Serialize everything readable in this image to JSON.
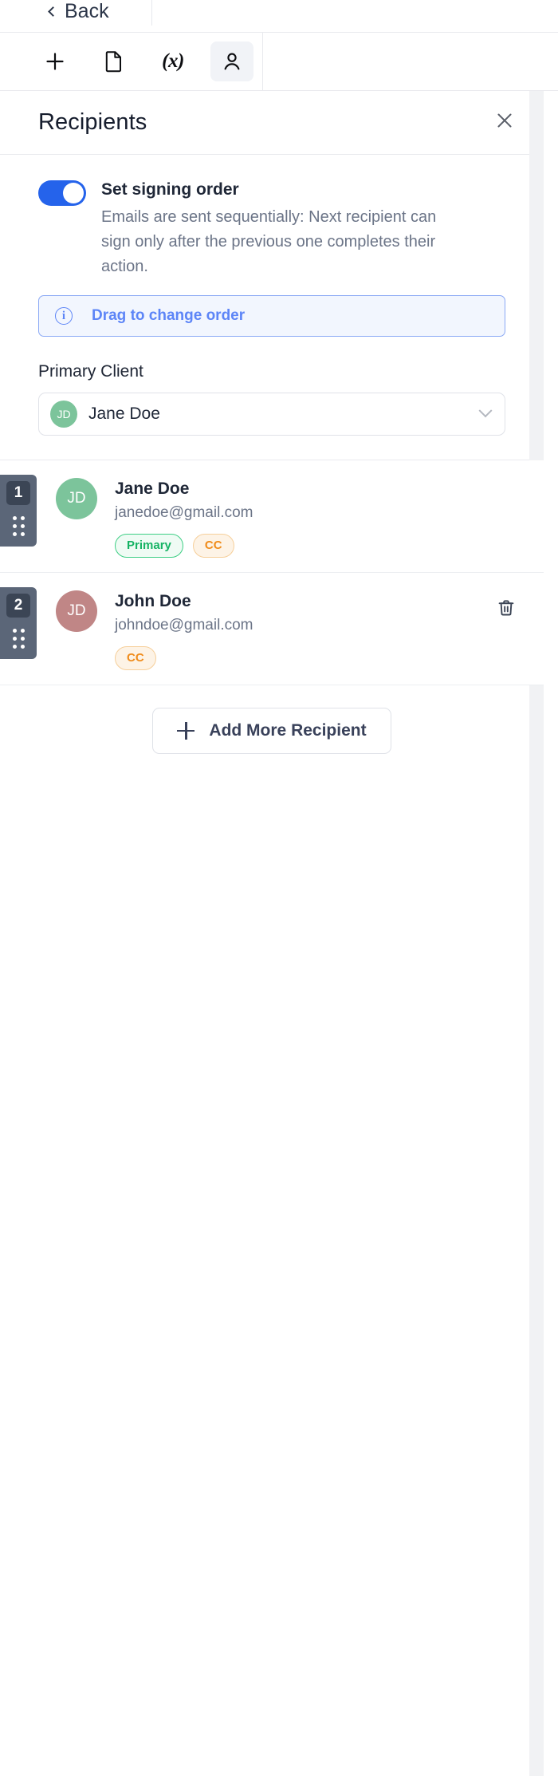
{
  "topbar": {
    "back_label": "Back",
    "back_icon": "chevron-left-icon"
  },
  "toolbar": {
    "tools": [
      {
        "id": "add",
        "icon": "plus-icon",
        "label": "",
        "active": false
      },
      {
        "id": "document",
        "icon": "document-icon",
        "label": "",
        "active": false
      },
      {
        "id": "variable",
        "icon": "variable-icon",
        "label": "(x)",
        "active": false
      },
      {
        "id": "recipients",
        "icon": "person-icon",
        "label": "",
        "active": true
      }
    ]
  },
  "panel": {
    "title": "Recipients",
    "close_icon": "close-icon"
  },
  "signing_order": {
    "toggle_on": true,
    "label": "Set signing order",
    "description": "Emails are sent sequentially: Next recipient can sign only after the previous one completes their action.",
    "banner": {
      "icon": "info-icon",
      "glyph": "i",
      "text": "Drag to change order"
    }
  },
  "primary_client": {
    "label": "Primary Client",
    "selected": {
      "initials": "JD",
      "name": "Jane Doe",
      "avatar_color": "#7cc49b"
    },
    "chevron_icon": "chevron-down-icon"
  },
  "recipients": [
    {
      "order": "1",
      "initials": "JD",
      "avatar_color": "#7cc49b",
      "name": "Jane Doe",
      "email": "janedoe@gmail.com",
      "badges": [
        {
          "type": "primary",
          "label": "Primary"
        },
        {
          "type": "cc",
          "label": "CC"
        }
      ],
      "deletable": false,
      "drag_icon": "drag-dots-icon"
    },
    {
      "order": "2",
      "initials": "JD",
      "avatar_color": "#c08686",
      "name": "John Doe",
      "email": "johndoe@gmail.com",
      "badges": [
        {
          "type": "cc",
          "label": "CC"
        }
      ],
      "deletable": true,
      "delete_icon": "trash-icon",
      "drag_icon": "drag-dots-icon"
    }
  ],
  "add_recipient": {
    "label": "Add More Recipient",
    "icon": "plus-icon"
  },
  "colors": {
    "accent_blue": "#2563eb",
    "banner_blue": "#5d85f7",
    "badge_green": "#16b364",
    "badge_orange": "#f08c1b",
    "drag_handle": "#5b6678",
    "text_primary": "#1f2737",
    "text_muted": "#6b7487"
  }
}
